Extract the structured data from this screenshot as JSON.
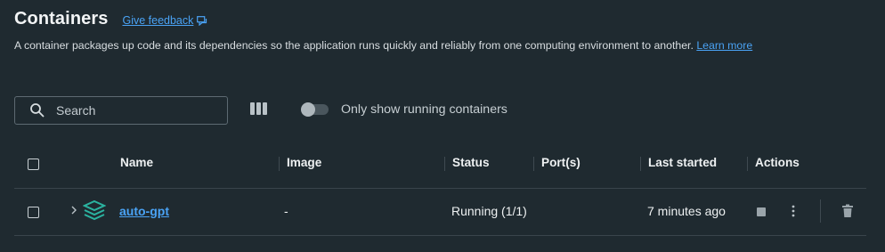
{
  "header": {
    "title": "Containers",
    "feedback_label": "Give feedback",
    "description": "A container packages up code and its dependencies so the application runs quickly and reliably from one computing environment to another.",
    "learn_more": "Learn more"
  },
  "toolbar": {
    "search_placeholder": "Search",
    "toggle_label": "Only show running containers",
    "toggle_on": false
  },
  "table": {
    "columns": [
      "Name",
      "Image",
      "Status",
      "Port(s)",
      "Last started",
      "Actions"
    ],
    "rows": [
      {
        "name": "auto-gpt",
        "image": "-",
        "status": "Running (1/1)",
        "ports": "",
        "last_started": "7 minutes ago"
      }
    ]
  },
  "colors": {
    "background": "#1f2a30",
    "link": "#4aa3f5",
    "container_icon": "#2bb3a0"
  },
  "icons": [
    "feedback-icon",
    "search-icon",
    "columns-icon",
    "chevron-right-icon",
    "container-stack-icon",
    "stop-icon",
    "more-vertical-icon",
    "trash-icon"
  ]
}
